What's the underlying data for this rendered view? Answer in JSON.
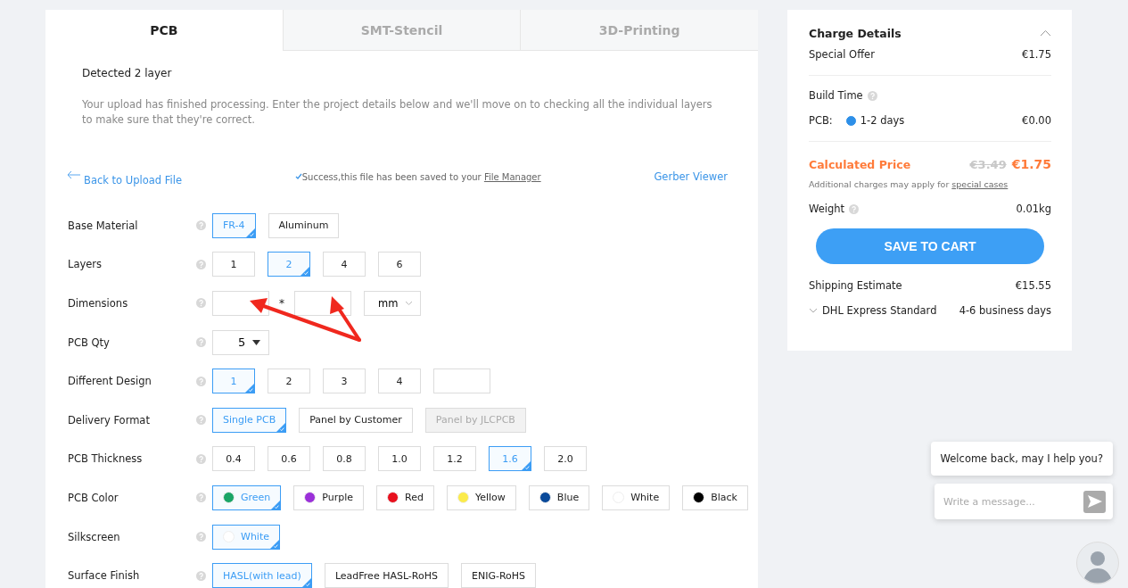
{
  "tabs": [
    {
      "label": "PCB",
      "selected": true
    },
    {
      "label": "SMT-Stencil",
      "selected": false
    },
    {
      "label": "3D-Printing",
      "selected": false
    }
  ],
  "intro": {
    "detected": "Detected 2 layer",
    "message": "Your upload has finished processing. Enter the project details below and we'll move on to checking all the individual layers to make sure that they're correct."
  },
  "links": {
    "back": "Back to Upload File",
    "success_text": "Success,this file has been saved to your",
    "success_link": "File Manager",
    "viewer": "Gerber Viewer"
  },
  "rows": [
    {
      "label": "Base Material",
      "kind": "options",
      "options": [
        {
          "label": "FR-4",
          "selected": true
        },
        {
          "label": "Aluminum",
          "selected": false
        }
      ]
    },
    {
      "label": "Layers",
      "kind": "options",
      "options": [
        {
          "label": "1",
          "selected": false
        },
        {
          "label": "2",
          "selected": true
        },
        {
          "label": "4",
          "selected": false
        },
        {
          "label": "6",
          "selected": false
        }
      ]
    },
    {
      "label": "Dimensions",
      "kind": "dimensions",
      "separator": "*",
      "unit": "mm"
    },
    {
      "label": "PCB Qty",
      "kind": "select",
      "value": "5"
    },
    {
      "label": "Different Design",
      "kind": "options",
      "custom_field": true,
      "options": [
        {
          "label": "1",
          "selected": true
        },
        {
          "label": "2",
          "selected": false
        },
        {
          "label": "3",
          "selected": false
        },
        {
          "label": "4",
          "selected": false
        }
      ]
    },
    {
      "label": "Delivery Format",
      "kind": "options",
      "options": [
        {
          "label": "Single PCB",
          "selected": true
        },
        {
          "label": "Panel by Customer",
          "selected": false
        },
        {
          "label": "Panel by JLCPCB",
          "selected": false,
          "disabled": true
        }
      ]
    },
    {
      "label": "PCB Thickness",
      "kind": "options",
      "options": [
        {
          "label": "0.4",
          "selected": false
        },
        {
          "label": "0.6",
          "selected": false
        },
        {
          "label": "0.8",
          "selected": false
        },
        {
          "label": "1.0",
          "selected": false
        },
        {
          "label": "1.2",
          "selected": false
        },
        {
          "label": "1.6",
          "selected": true
        },
        {
          "label": "2.0",
          "selected": false
        }
      ]
    },
    {
      "label": "PCB Color",
      "kind": "options",
      "options": [
        {
          "label": "Green",
          "selected": true,
          "color": "#1aa567"
        },
        {
          "label": "Purple",
          "selected": false,
          "color": "#9b30d9"
        },
        {
          "label": "Red",
          "selected": false,
          "color": "#e8101e"
        },
        {
          "label": "Yellow",
          "selected": false,
          "color": "#fbeb4b"
        },
        {
          "label": "Blue",
          "selected": false,
          "color": "#0a4a9a"
        },
        {
          "label": "White",
          "selected": false,
          "color": "#ffffff"
        },
        {
          "label": "Black",
          "selected": false,
          "color": "#000000"
        }
      ]
    },
    {
      "label": "Silkscreen",
      "kind": "options",
      "options": [
        {
          "label": "White",
          "selected": true,
          "color": "#ffffff"
        }
      ]
    },
    {
      "label": "Surface Finish",
      "kind": "options",
      "options": [
        {
          "label": "HASL(with lead)",
          "selected": true
        },
        {
          "label": "LeadFree HASL-RoHS",
          "selected": false
        },
        {
          "label": "ENIG-RoHS",
          "selected": false
        }
      ]
    }
  ],
  "charges": {
    "title": "Charge Details",
    "expanded": true,
    "special_offer": {
      "label": "Special Offer",
      "value": "€1.75"
    },
    "build_time": "Build Time",
    "pcb_label": "PCB:",
    "build_option": {
      "label": "1-2 days",
      "selected": true
    },
    "build_price": "€0.00",
    "calculated_label": "Calculated Price",
    "old_price": "€3.49",
    "new_price": "€1.75",
    "note": "Additional charges may apply for",
    "note_link": "special cases",
    "weight_label": "Weight",
    "weight": "0.01kg",
    "button": "SAVE TO CART",
    "shipping_label": "Shipping Estimate",
    "shipping": "€15.55",
    "carrier": "DHL Express Standard",
    "carrier_days": "4-6 business days"
  },
  "chat": {
    "greeting": "Welcome back, may I help you?",
    "placeholder": "Write a message..."
  }
}
